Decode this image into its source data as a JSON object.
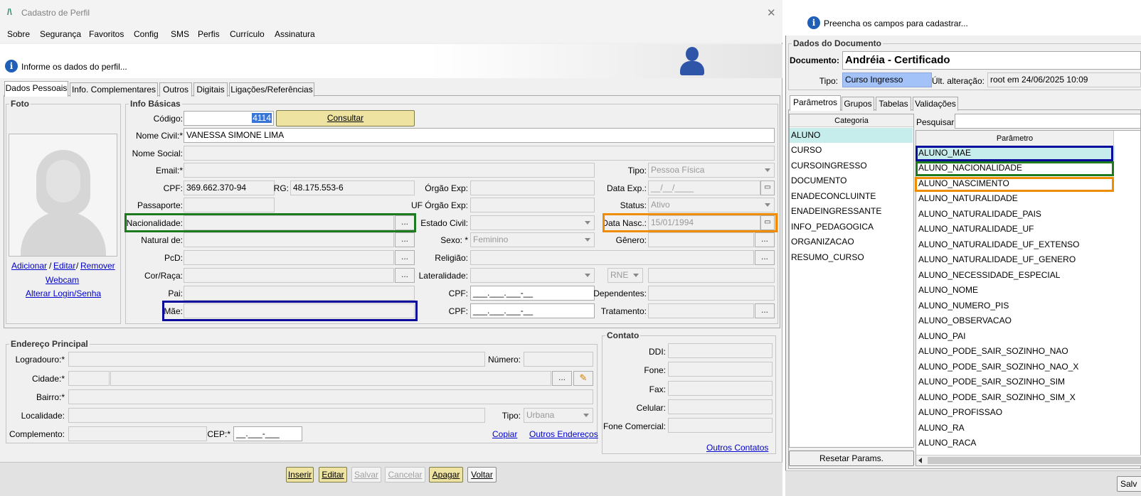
{
  "window": {
    "title": "Cadastro de Perfil",
    "close_glyph": "✕"
  },
  "menu": [
    {
      "label": "Sobre"
    },
    {
      "label": "Segurança"
    },
    {
      "label": "Favoritos"
    },
    {
      "label": "Config"
    },
    {
      "label": "SMS"
    },
    {
      "label": "Perfis"
    },
    {
      "label": "Currículo"
    },
    {
      "label": "Assinatura"
    }
  ],
  "info_bar": {
    "text": "Informe os dados do perfil..."
  },
  "tabs": [
    {
      "label": "Dados Pessoais"
    },
    {
      "label": "Info. Complementares"
    },
    {
      "label": "Outros"
    },
    {
      "label": "Digitais"
    },
    {
      "label": "Ligações/Referências"
    }
  ],
  "foto": {
    "title": "Foto",
    "add": "Adicionar",
    "sep1": "/",
    "edit": "Editar",
    "sep2": "/",
    "remove": "Remover",
    "webcam": "Webcam",
    "login": "Alterar Login/Senha"
  },
  "info_basicas": {
    "title": "Info Básicas",
    "codigo_label": "Código:",
    "codigo_value": "4114",
    "consultar": "Consultar",
    "nome_civil_label": "Nome Civil:*",
    "nome_civil_value": "VANESSA SIMONE LIMA",
    "nome_social_label": "Nome Social:",
    "email_label": "Email:*",
    "tipo_label": "Tipo:",
    "tipo_value": "Pessoa Física",
    "cpf_label": "CPF:",
    "cpf_value": "369.662.370-94",
    "rg_label": "RG:",
    "rg_value": "48.175.553-6",
    "orgao_exp_label": "Órgão Exp:",
    "data_exp_label": "Data Exp.:",
    "data_exp_value": "__/__/____",
    "passaporte_label": "Passaporte:",
    "uf_orgao_label": "UF Órgão Exp:",
    "status_label": "Status:",
    "status_value": "Ativo",
    "nacionalidade_label": "Nacionalidade:",
    "estado_civil_label": "Estado Civil:",
    "data_nasc_label": "Data Nasc.:",
    "data_nasc_value": "15/01/1994",
    "natural_label": "Natural de:",
    "sexo_label": "Sexo: *",
    "sexo_value": "Feminino",
    "genero_label": "Gênero:",
    "pcd_label": "PcD:",
    "religiao_label": "Religião:",
    "cor_label": "Cor/Raça:",
    "lateralidade_label": "Lateralidade:",
    "rne_value": "RNE",
    "pai_label": "Pai:",
    "cpf_pai_label": "CPF:",
    "cpf_pai_value": "___.___.___-__",
    "dependentes_label": "Dependentes:",
    "mae_label": "Mãe:",
    "cpf_mae_label": "CPF:",
    "cpf_mae_value": "___.___.___-__",
    "tratamento_label": "Tratamento:",
    "dots": "..."
  },
  "endereco": {
    "title": "Endereço Principal",
    "logradouro_label": "Logradouro:*",
    "numero_label": "Número:",
    "cidade_label": "Cidade:*",
    "bairro_label": "Bairro:*",
    "localidade_label": "Localidade:",
    "tipo_label": "Tipo:",
    "tipo_value": "Urbana",
    "complemento_label": "Complemento:",
    "cep_label": "CEP:*",
    "cep_value": "__.___-___",
    "copiar": "Copiar",
    "outros_enderecos": "Outros Endereços"
  },
  "contato": {
    "title": "Contato",
    "ddi_label": "DDI:",
    "fone_label": "Fone:",
    "fax_label": "Fax:",
    "celular_label": "Celular:",
    "fone_comercial_label": "Fone Comercial:",
    "outros_contatos": "Outros Contatos"
  },
  "actions": {
    "inserir": "Inserir",
    "editar": "Editar",
    "salvar": "Salvar",
    "cancelar": "Cancelar",
    "apagar": "Apagar",
    "voltar": "Voltar"
  },
  "right": {
    "hint": "Preencha os campos para cadastrar...",
    "dados_doc": "Dados do Documento",
    "documento_label": "Documento:",
    "documento_value": "Andréia - Certificado",
    "tipo_label": "Tipo:",
    "tipo_value": "Curso Ingresso",
    "ult_label": "Últ. alteração:",
    "ult_value": "root em 24/06/2025 10:09",
    "tabs": [
      {
        "label": "Parâmetros"
      },
      {
        "label": "Grupos"
      },
      {
        "label": "Tabelas"
      },
      {
        "label": "Validações"
      }
    ],
    "categoria_header": "Categoria",
    "categorias": [
      "ALUNO",
      "CURSO",
      "CURSOINGRESSO",
      "DOCUMENTO",
      "ENADECONCLUINTE",
      "ENADEINGRESSANTE",
      "INFO_PEDAGOGICA",
      "ORGANIZACAO",
      "RESUMO_CURSO"
    ],
    "pesquisar_label": "Pesquisar:",
    "parametro_header": "Parâmetro",
    "parametros": [
      "ALUNO_MAE",
      "ALUNO_NACIONALIDADE",
      "ALUNO_NASCIMENTO",
      "ALUNO_NATURALIDADE",
      "ALUNO_NATURALIDADE_PAIS",
      "ALUNO_NATURALIDADE_UF",
      "ALUNO_NATURALIDADE_UF_EXTENSO",
      "ALUNO_NATURALIDADE_UF_GENERO",
      "ALUNO_NECESSIDADE_ESPECIAL",
      "ALUNO_NOME",
      "ALUNO_NUMERO_PIS",
      "ALUNO_OBSERVACAO",
      "ALUNO_PAI",
      "ALUNO_PODE_SAIR_SOZINHO_NAO",
      "ALUNO_PODE_SAIR_SOZINHO_NAO_X",
      "ALUNO_PODE_SAIR_SOZINHO_SIM",
      "ALUNO_PODE_SAIR_SOZINHO_SIM_X",
      "ALUNO_PROFISSAO",
      "ALUNO_RA",
      "ALUNO_RACA"
    ],
    "resetar": "Resetar Params.",
    "salvar_partial": "Salv"
  },
  "colors": {
    "highlight_blue": "#0a0a9c",
    "highlight_green": "#1e7a1e",
    "highlight_orange": "#f08c00",
    "selected_row": "#c6ecec",
    "tipo_bg": "#a3c2f7",
    "button_yellow": "#efe3a2"
  }
}
